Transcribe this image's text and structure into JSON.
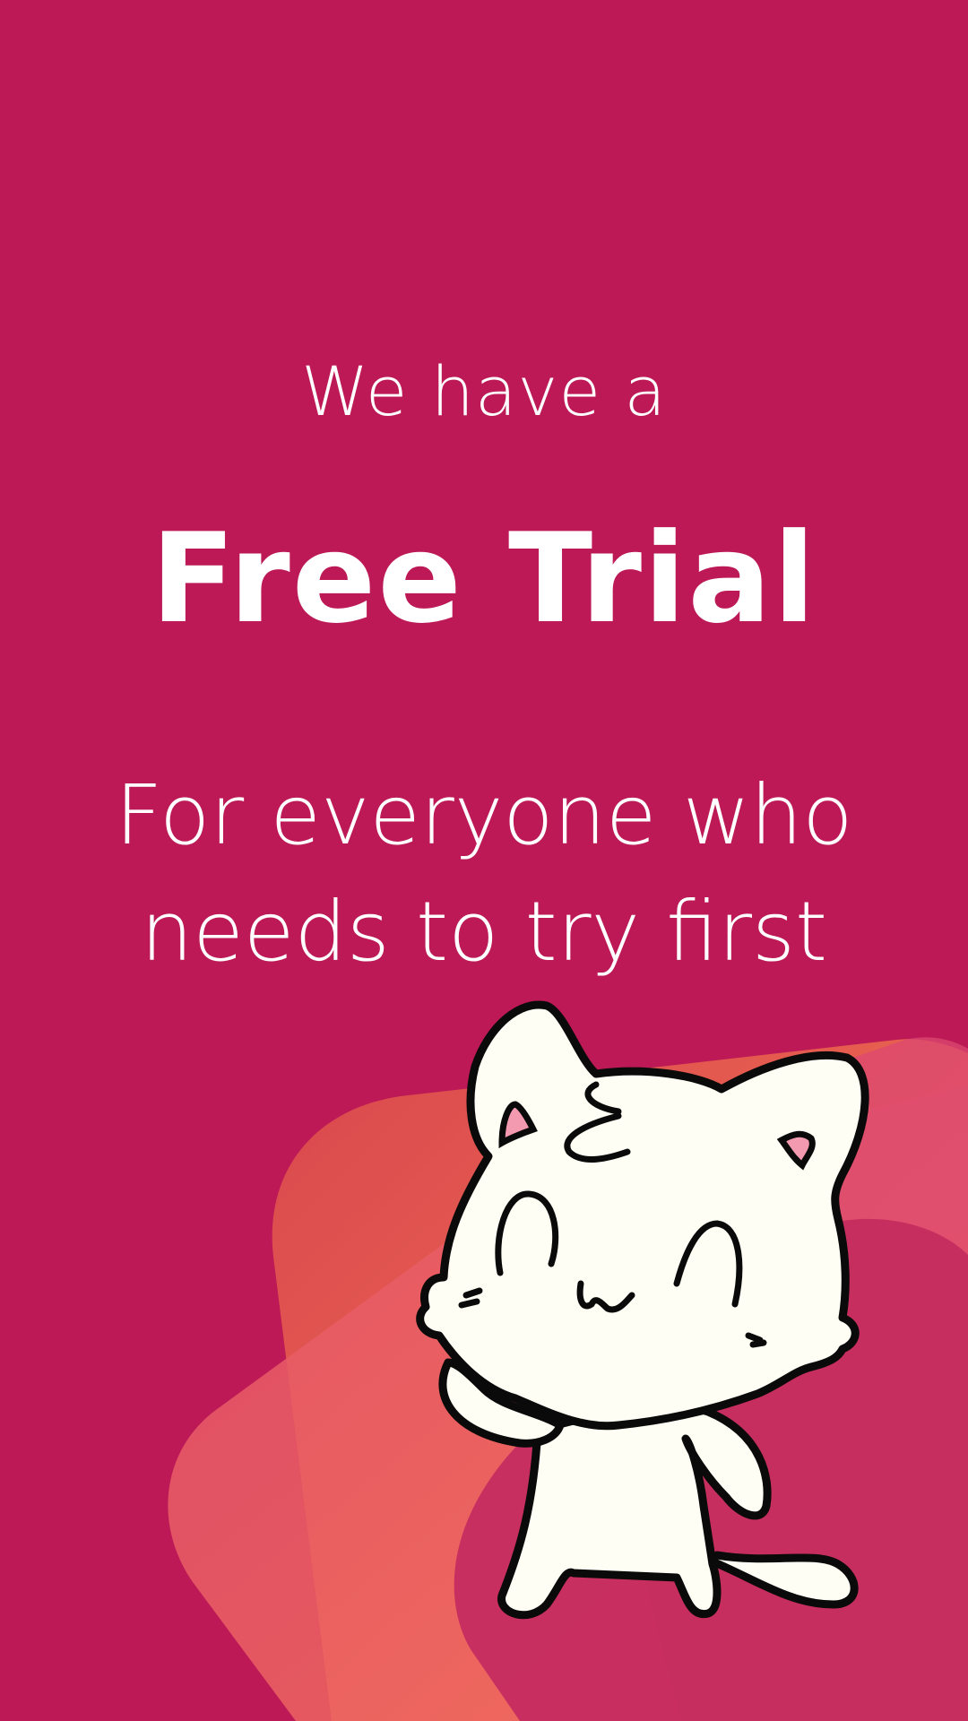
{
  "promo": {
    "intro": "We have a",
    "headline": "Free Trial",
    "subline_1": "For everyone who",
    "subline_2": "needs to try first"
  },
  "colors": {
    "background": "#bc1956",
    "text": "#ffffff",
    "cat_fill": "#fffef4",
    "cat_outline": "#0a0a0a"
  },
  "illustration": {
    "icon": "cat-mascot-icon"
  }
}
